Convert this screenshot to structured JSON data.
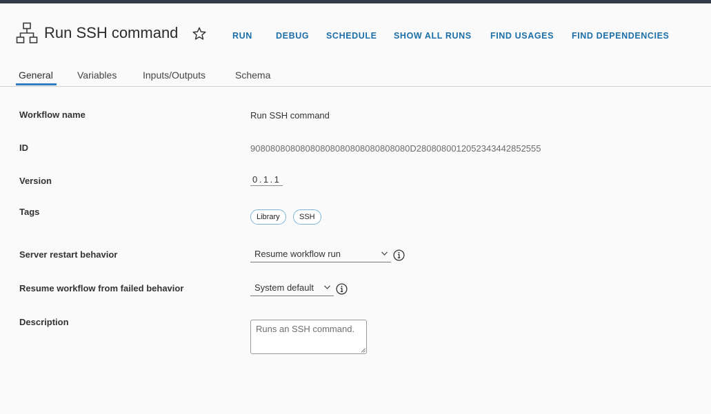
{
  "header": {
    "title": "Run SSH command",
    "actions": [
      "RUN",
      "DEBUG",
      "SCHEDULE",
      "SHOW ALL RUNS",
      "FIND USAGES",
      "FIND DEPENDENCIES"
    ]
  },
  "tabs": [
    "General",
    "Variables",
    "Inputs/Outputs",
    "Schema"
  ],
  "active_tab": "General",
  "fields": {
    "workflow_name": {
      "label": "Workflow name",
      "value": "Run SSH command"
    },
    "id": {
      "label": "ID",
      "value": "90808080808080808080808080808080D280808001205234344285​2555"
    },
    "version": {
      "label": "Version",
      "value": "0.1.1"
    },
    "tags": {
      "label": "Tags",
      "values": [
        "Library",
        "SSH"
      ]
    },
    "server_restart": {
      "label": "Server restart behavior",
      "selected": "Resume workflow run"
    },
    "resume_failed": {
      "label": "Resume workflow from failed behavior",
      "selected": "System default"
    },
    "description": {
      "label": "Description",
      "placeholder": "Runs an SSH command."
    }
  },
  "icons": {
    "workflow": "workflow-tree-icon",
    "favorite": "star-icon",
    "info": "info-icon",
    "dropdown": "chevron-down-icon"
  },
  "colors": {
    "accent": "#1b6ea8",
    "tab_underline": "#2f7bbd",
    "tag_border": "#79b4d8",
    "top_bar": "#313c46"
  }
}
